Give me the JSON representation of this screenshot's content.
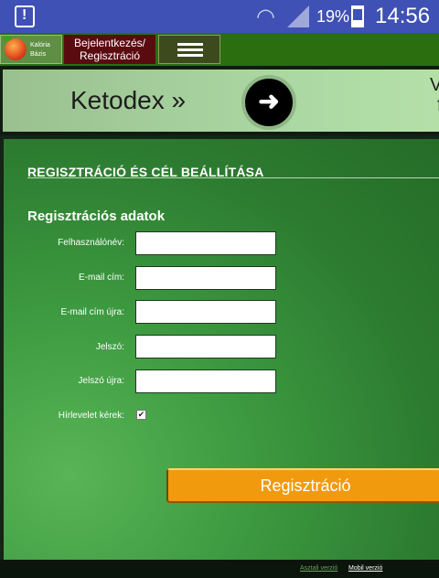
{
  "status_bar": {
    "battery_percent": "19%",
    "time": "14:56"
  },
  "nav": {
    "logo_line1": "Kalória",
    "logo_line2": "Bázis",
    "login_line1": "Bejelentkezés/",
    "login_line2": "Regisztráció"
  },
  "banner": {
    "title": "Ketodex »",
    "edge_text1": "V",
    "edge_text2": "f"
  },
  "form": {
    "section_title": "REGISZTRÁCIÓ ÉS CÉL BEÁLLÍTÁSA",
    "sub_title": "Regisztrációs adatok",
    "fields": [
      {
        "label": "Felhasználónév:",
        "value": ""
      },
      {
        "label": "E-mail cím:",
        "value": ""
      },
      {
        "label": "E-mail cím újra:",
        "value": ""
      },
      {
        "label": "Jelszó:",
        "value": ""
      },
      {
        "label": "Jelszó újra:",
        "value": ""
      }
    ],
    "newsletter_label": "Hírlevelet kérek:",
    "newsletter_checked": true,
    "newsletter_mark": "✔",
    "submit_label": "Regisztráció"
  },
  "footer": {
    "desktop_link": "Asztali verzió",
    "mobile_link": "Mobil verzió"
  },
  "colors": {
    "status_bar": "#3f51b5",
    "nav_bg": "#2b6e10",
    "panel_green": "#2c7b30",
    "button_orange": "#f29a0e",
    "login_bg": "#5a0b10"
  }
}
